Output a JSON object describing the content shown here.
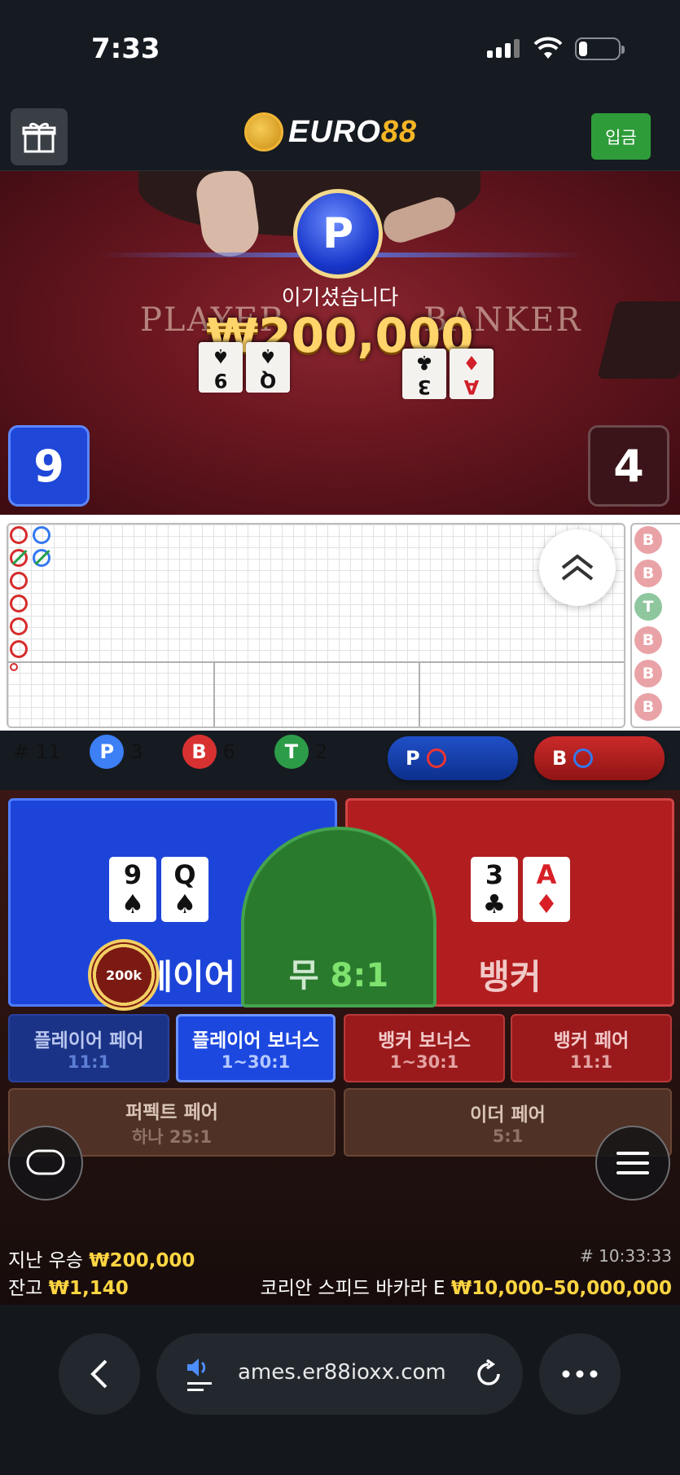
{
  "status_bar": {
    "time": "7:33"
  },
  "header": {
    "brand_main": "EURO",
    "brand_accent": "88",
    "deposit_label": "입금"
  },
  "result": {
    "winner_badge": "P",
    "win_message": "이기셨습니다",
    "win_amount": "₩200,000",
    "felt_player": "PLAYER",
    "felt_banker": "BANKER",
    "player_score": "9",
    "banker_score": "4",
    "player_cards": [
      {
        "rank": "9",
        "suit": "♠"
      },
      {
        "rank": "Q",
        "suit": "♠"
      }
    ],
    "banker_cards": [
      {
        "rank": "3",
        "suit": "♣"
      },
      {
        "rank": "A",
        "suit": "♦"
      }
    ]
  },
  "roadmap": {
    "side_results": [
      "B",
      "B",
      "T",
      "B",
      "B",
      "B"
    ],
    "stats": {
      "round_label": "# 11",
      "player_label": "P",
      "player_count": "3",
      "banker_label": "B",
      "banker_count": "6",
      "tie_label": "T",
      "tie_count": "2"
    },
    "ask_player": "P",
    "ask_banker": "B"
  },
  "betting": {
    "player_label": "플레이어",
    "tie_label": "무",
    "tie_odds": "8:1",
    "banker_label": "뱅커",
    "chip_value": "200k",
    "side_bets": [
      {
        "label": "플레이어 페어",
        "odds": "11:1"
      },
      {
        "label": "플레이어 보너스",
        "odds": "1~30:1"
      },
      {
        "label": "뱅커 보너스",
        "odds": "1~30:1"
      },
      {
        "label": "뱅커 페어",
        "odds": "11:1"
      },
      {
        "label": "퍼펙트 페어",
        "odds": "하나 25:1"
      },
      {
        "label": "이더 페어",
        "odds": "5:1"
      }
    ]
  },
  "footer_info": {
    "last_win_label": "지난 우승",
    "last_win_amount": "₩200,000",
    "balance_label": "잔고",
    "balance_amount": "₩1,140",
    "round_id": "# 10:33:33",
    "table_name": "코리안 스피드 바카라 E",
    "table_limits": "₩10,000–50,000,000"
  },
  "browser": {
    "url": "ames.er88ioxx.com"
  },
  "colors": {
    "player_blue": "#1d44d9",
    "banker_red": "#b21d1f",
    "tie_green": "#2a7a2e",
    "accent_gold": "#ffd542",
    "deposit_green": "#2f9c3a"
  }
}
